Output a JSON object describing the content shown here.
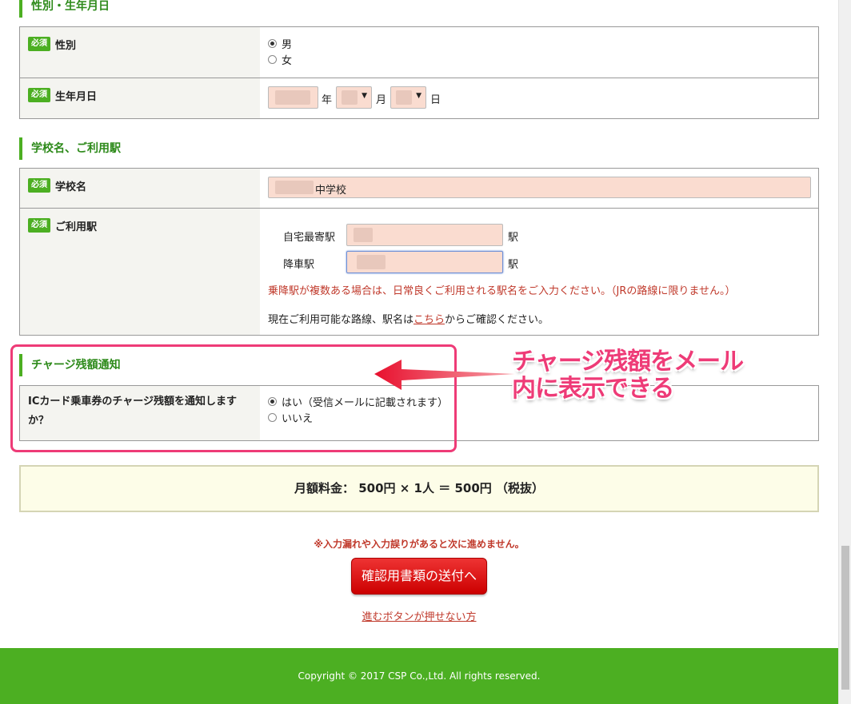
{
  "sections": {
    "gender_birth": "性別・生年月日",
    "school_station": "学校名、ご利用駅",
    "charge": "チャージ残額通知"
  },
  "required_badge": "必須",
  "gender": {
    "label": "性別",
    "options": [
      "男",
      "女"
    ],
    "selected": "男"
  },
  "birth": {
    "label": "生年月日",
    "year_unit": "年",
    "month_unit": "月",
    "day_unit": "日"
  },
  "school": {
    "label": "学校名",
    "value_suffix": "中学校"
  },
  "station": {
    "label": "ご利用駅",
    "home_label": "自宅最寄駅",
    "exit_label": "降車駅",
    "unit": "駅",
    "note_red": "乗降駅が複数ある場合は、日常良くご利用される駅名をご入力ください。（JRの路線に限りません。）",
    "note_prefix": "現在ご利用可能な路線、駅名は",
    "note_link": "こちら",
    "note_suffix": "からご確認ください。"
  },
  "charge": {
    "question_line1": "ICカード乗車券のチャージ残額を通知します",
    "question_line2": "か？",
    "options": [
      "はい（受信メールに記載されます）",
      "いいえ"
    ],
    "selected": "はい（受信メールに記載されます）"
  },
  "fee": "月額料金：  500円 × 1人 ＝ 500円 （税抜）",
  "warning": "※入力漏れや入力誤りがあると次に進めません。",
  "submit_label": "確認用書類の送付へ",
  "help_link": "進むボタンが押せない方",
  "footer": "Copyright © 2017 CSP Co.,Ltd. All rights reserved.",
  "annotation": {
    "line1": "チャージ残額をメール",
    "line2": "内に表示できる",
    "color": "#ee3b77"
  }
}
